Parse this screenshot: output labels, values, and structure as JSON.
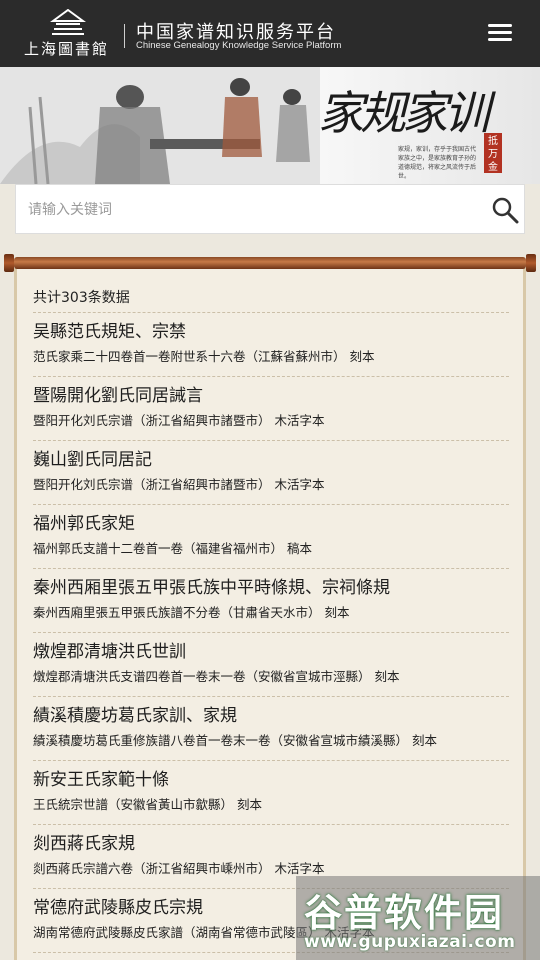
{
  "header": {
    "logo_cn": "上海圖書館",
    "title": "中国家谱知识服务平台",
    "subtitle": "Chinese Genealogy Knowledge Service Platform",
    "menu_icon": "hamburger-menu-icon"
  },
  "banner": {
    "title": "家规家训",
    "stamp": "抵万金",
    "note": "家规，家训，存乎于我国古代家族之中，是家族教育子孙的道德规范，将家之风流传于后世。"
  },
  "search": {
    "placeholder": "请输入关键词",
    "value": "",
    "icon": "search-icon"
  },
  "results": {
    "count_label": "共计303条数据",
    "items": [
      {
        "title": "吴縣范氏規矩、宗禁",
        "sub": "范氏家乘二十四卷首一卷附世系十六卷（江蘇省蘇州市） 刻本"
      },
      {
        "title": "暨陽開化劉氏同居誡言",
        "sub": "暨阳开化刘氏宗谱（浙江省紹興市諸暨市） 木活字本"
      },
      {
        "title": "巍山劉氏同居記",
        "sub": "暨阳开化刘氏宗谱（浙江省紹興市諸暨市） 木活字本"
      },
      {
        "title": "福州郭氏家矩",
        "sub": "福州郭氏支譜十二卷首一卷（福建省福州市） 稿本"
      },
      {
        "title": "秦州西厢里張五甲張氏族中平時條規、宗祠條規",
        "sub": "秦州西廂里張五甲張氏族譜不分卷（甘肅省天水市） 刻本"
      },
      {
        "title": "燉煌郡清塘洪氏世訓",
        "sub": "燉煌郡清塘洪氏支谱四卷首一卷末一卷（安徽省宣城市涇縣） 刻本"
      },
      {
        "title": "績溪積慶坊葛氏家訓、家規",
        "sub": "績溪積慶坊葛氏重修族譜八卷首一卷末一卷（安徽省宣城市績溪縣） 刻本"
      },
      {
        "title": "新安王氏家範十條",
        "sub": "王氏統宗世譜（安徽省黃山市歙縣） 刻本"
      },
      {
        "title": "剡西蔣氏家規",
        "sub": "剡西蔣氏宗譜六卷（浙江省紹興市嵊州市） 木活字本"
      },
      {
        "title": "常德府武陵縣皮氏宗規",
        "sub": "湖南常德府武陵縣皮氏家譜（湖南省常德市武陵區） 木活字本"
      }
    ]
  },
  "watermark": {
    "main": "谷普软件园",
    "url": "www.gupuxiazai.com"
  }
}
